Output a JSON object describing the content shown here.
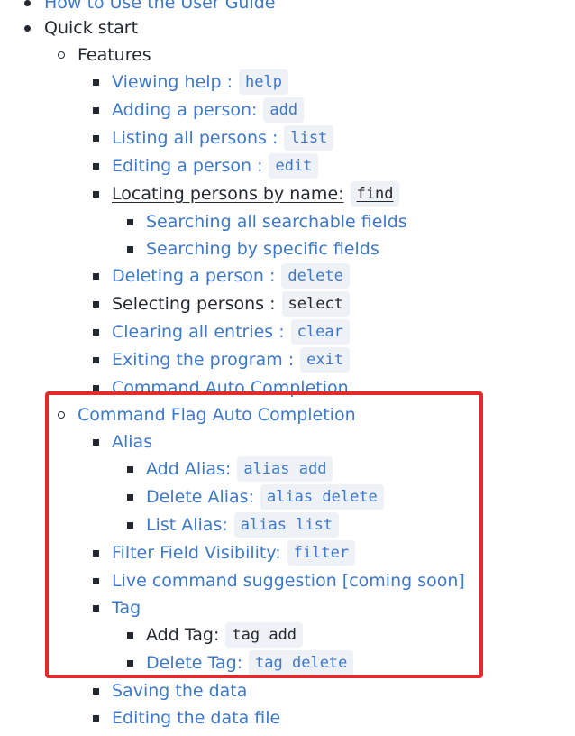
{
  "toc": {
    "how_to_use": "How to Use the User Guide",
    "quick_start": "Quick start",
    "features": "Features",
    "viewing_help": {
      "label": "Viewing help :",
      "code": "help"
    },
    "adding_person": {
      "label": "Adding a person:",
      "code": "add"
    },
    "listing_persons": {
      "label": "Listing all persons :",
      "code": "list"
    },
    "editing_person": {
      "label": "Editing a person :",
      "code": "edit"
    },
    "locating_persons": {
      "label": "Locating persons by name:",
      "code": "find"
    },
    "searching_all": "Searching all searchable fields",
    "searching_specific": "Searching by specific fields",
    "deleting_person": {
      "label": "Deleting a person :",
      "code": "delete"
    },
    "selecting_persons": {
      "label": "Selecting persons :",
      "code": "select"
    },
    "clearing_entries": {
      "label": "Clearing all entries :",
      "code": "clear"
    },
    "exiting_program": {
      "label": "Exiting the program :",
      "code": "exit"
    },
    "command_auto_completion": "Command Auto Completion",
    "command_flag_auto_completion": "Command Flag Auto Completion",
    "alias": "Alias",
    "add_alias": {
      "label": "Add Alias:",
      "code": "alias add"
    },
    "delete_alias": {
      "label": "Delete Alias:",
      "code": "alias delete"
    },
    "list_alias": {
      "label": "List Alias:",
      "code": "alias list"
    },
    "filter_field": {
      "label": "Filter Field Visibility:",
      "code": "filter"
    },
    "live_suggestion": "Live command suggestion [coming soon]",
    "tag": "Tag",
    "add_tag": {
      "label": "Add Tag:",
      "code": "tag add"
    },
    "delete_tag": {
      "label": "Delete Tag:",
      "code": "tag delete"
    },
    "saving_data": "Saving the data",
    "editing_data_file": "Editing the data file"
  },
  "colors": {
    "link": "#3d78c9",
    "text": "#24292f",
    "code_bg": "#eef1f6",
    "highlight": "#e32b2b"
  }
}
